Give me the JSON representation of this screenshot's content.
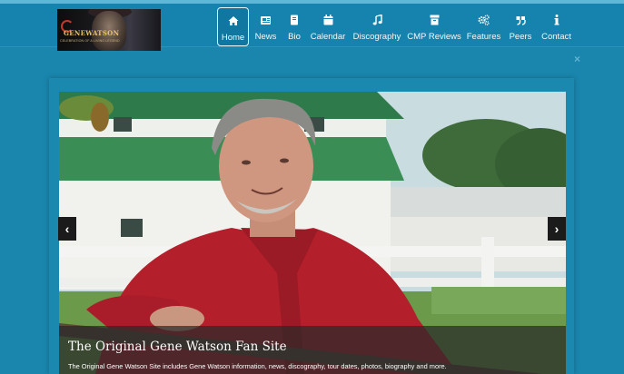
{
  "brand": {
    "logo_name": "GENEWATSON",
    "logo_tagline": "CELEBRATION OF A LIVING LEGEND"
  },
  "nav": {
    "items": [
      {
        "label": "Home",
        "icon": "home-icon"
      },
      {
        "label": "News",
        "icon": "newspaper-icon"
      },
      {
        "label": "Bio",
        "icon": "book-icon"
      },
      {
        "label": "Calendar",
        "icon": "calendar-icon"
      },
      {
        "label": "Discography",
        "icon": "music-note-icon"
      },
      {
        "label": "CMP Reviews",
        "icon": "archive-icon"
      },
      {
        "label": "Features",
        "icon": "cogs-icon"
      },
      {
        "label": "Peers",
        "icon": "quote-icon"
      },
      {
        "label": "Contact",
        "icon": "info-icon"
      }
    ],
    "active": "Home"
  },
  "modal": {
    "close_label": "×"
  },
  "carousel": {
    "prev_label": "‹",
    "next_label": "›",
    "caption_title": "The Original Gene Watson Fan Site",
    "caption_text": "The Original Gene Watson Site includes Gene Watson information, news, discography, tour dates, photos, biography and more."
  },
  "colors": {
    "background": "#1a86ae",
    "navbar": "#1583ad",
    "shirt": "#b3202c"
  }
}
